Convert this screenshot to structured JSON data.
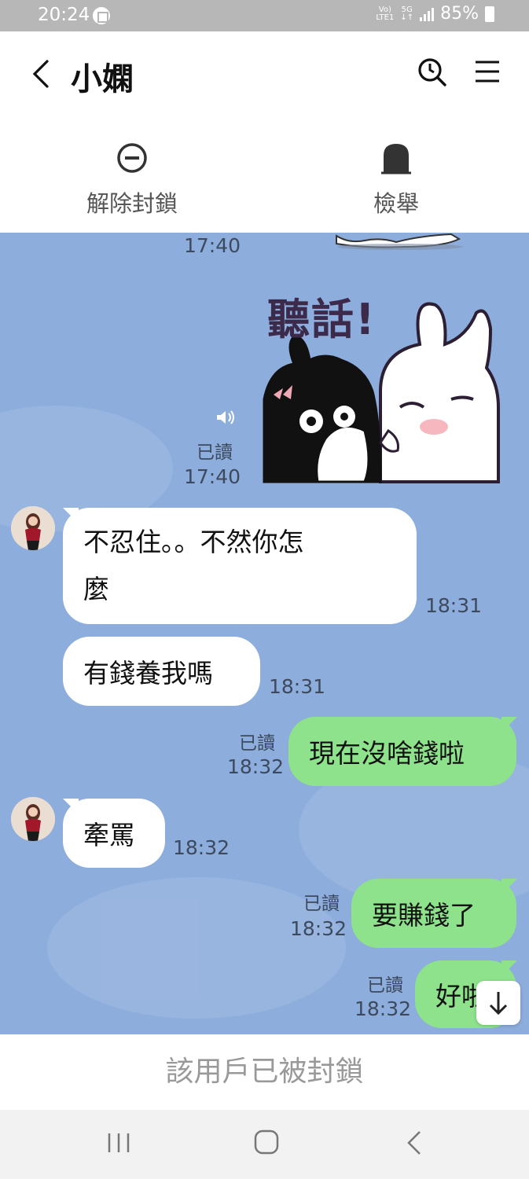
{
  "status_bar": {
    "time": "20:24",
    "network_top": "Vo)",
    "network_bottom": "LTE1",
    "gen_top": "5G",
    "gen_bottom": "↓↑",
    "battery": "85%"
  },
  "header": {
    "title": "小嫻",
    "unblock_label": "解除封鎖",
    "report_label": "檢舉"
  },
  "messages": {
    "top_partial_time": "17:40",
    "sticker_text": "聽話!",
    "sticker_read": "已讀",
    "sticker_time": "17:40",
    "m1_text_line1": "不忍住。。不然你怎",
    "m1_text_line2": "麼",
    "m1_time": "18:31",
    "m2_text": "有錢養我嗎",
    "m2_time": "18:31",
    "m3_read": "已讀",
    "m3_time": "18:32",
    "m3_text": "現在沒啥錢啦",
    "m4_text": "牽罵",
    "m4_time": "18:32",
    "m5_read": "已讀",
    "m5_time": "18:32",
    "m5_text": "要賺錢了",
    "m6_read": "已讀",
    "m6_time": "18:32",
    "m6_text": "好啦"
  },
  "footer": {
    "blocked_text": "該用戶已被封鎖"
  },
  "colors": {
    "chat_bg": "#8daddc",
    "outgoing_bubble": "#8de28b",
    "incoming_bubble": "#ffffff",
    "status_bar": "#b7b7b7"
  },
  "icons": [
    "back-icon",
    "search-icon",
    "menu-icon",
    "unblock-icon",
    "report-icon",
    "speaker-icon",
    "scroll-down-icon",
    "nav-recents-icon",
    "nav-home-icon",
    "nav-back-icon"
  ]
}
